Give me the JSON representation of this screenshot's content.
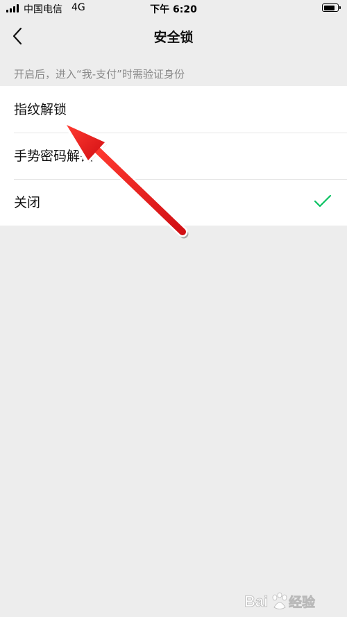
{
  "status_bar": {
    "carrier": "中国电信",
    "network": "4G",
    "time": "下午 6:20"
  },
  "nav": {
    "title": "安全锁",
    "back_icon": "chevron-left-icon"
  },
  "hint": "开启后，进入“我-支付”时需验证身份",
  "options": [
    {
      "label": "指纹解锁",
      "selected": false
    },
    {
      "label": "手势密码解锁",
      "selected": false
    },
    {
      "label": "关闭",
      "selected": true
    }
  ],
  "colors": {
    "background": "#ededed",
    "check": "#07c160",
    "annotation_arrow": "#e8151b"
  },
  "watermark": "Baidu经验"
}
